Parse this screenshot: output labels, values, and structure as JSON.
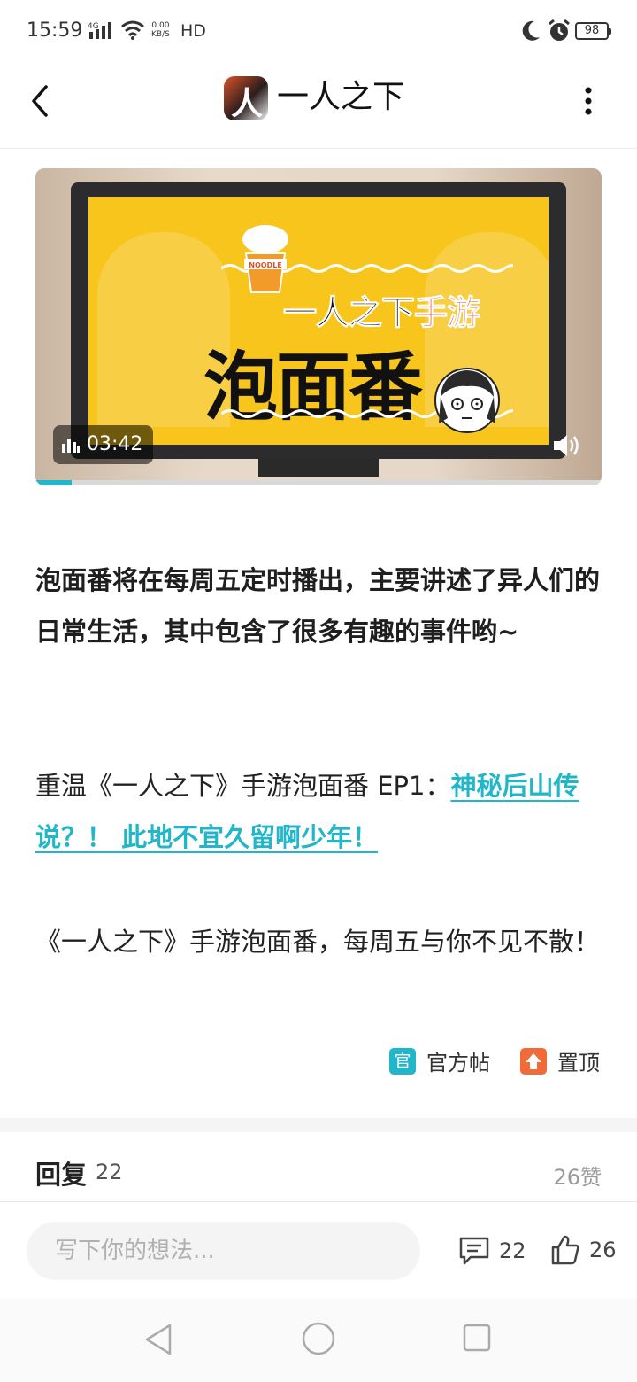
{
  "status_bar": {
    "time": "15:59",
    "network": "4G",
    "speed_top": "0.00",
    "speed_bottom": "KB/S",
    "hd": "HD",
    "battery": "98"
  },
  "header": {
    "title": "一人之下",
    "logo_glyph": "人"
  },
  "video": {
    "title_line1_prefix": "一人之下",
    "title_line1_suffix": "手游",
    "title_line2": "泡面番",
    "cup_label": "NOODLE",
    "duration": "03:42",
    "progress": 0.064,
    "accent": "#21b6c9",
    "screen_color": "#f7c51c"
  },
  "post": {
    "p1": "泡面番将在每周五定时播出，主要讲述了异人们的日常生活，其中包含了很多有趣的事件哟~",
    "p2_prefix": "重温《一人之下》手游泡面番 EP1：",
    "p2_link": "神秘后山传说？！ 此地不宜久留啊少年！",
    "p3": "《一人之下》手游泡面番，每周五与你不见不散！"
  },
  "tags": {
    "official_icon_text": "官",
    "official_label": "官方帖",
    "top_label": "置顶"
  },
  "replies": {
    "title": "回复",
    "count": "22",
    "likes": "26赞"
  },
  "bottom_bar": {
    "input_placeholder": "写下你的想法...",
    "comment_count": "22",
    "like_count": "26"
  },
  "icons": {
    "back": "chevron-left-icon",
    "more": "more-vertical-icon",
    "volume": "volume-icon",
    "comment": "comment-icon",
    "like": "thumbs-up-icon"
  }
}
